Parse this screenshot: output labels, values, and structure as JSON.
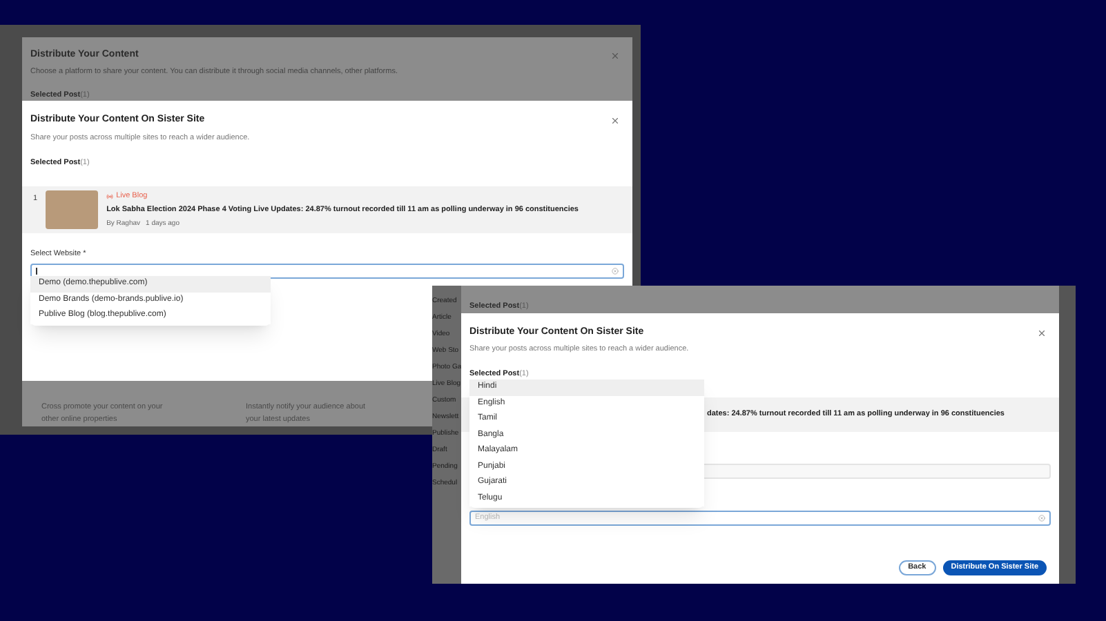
{
  "screenshot_1": {
    "back_modal": {
      "title": "Distribute Your Content",
      "subtitle": "Choose a platform to share your content. You can distribute it through social media channels, other platforms.",
      "selected_label": "Selected Post",
      "selected_count": "(1)",
      "options": [
        {
          "description": "Cross promote your content on your other online properties"
        },
        {
          "description": "Instantly notify your audience about your latest updates"
        }
      ]
    },
    "modal": {
      "title": "Distribute Your Content On Sister Site",
      "subtitle": "Share your posts across multiple sites to reach a wider audience.",
      "selected_label": "Selected Post",
      "selected_count": "(1)",
      "post": {
        "number": "1",
        "tag": "Live Blog",
        "headline": "Lok Sabha Election 2024 Phase 4 Voting Live Updates: 24.87% turnout recorded till 11 am as polling underway in 96 constituencies",
        "author": "By Raghav",
        "time": "1 days ago"
      },
      "website_label": "Select Website *",
      "website_options": [
        {
          "label": "Demo (demo.thepublive.com)",
          "selected": true
        },
        {
          "label": "Demo Brands (demo-brands.publive.io)",
          "selected": false
        },
        {
          "label": "Publive Blog (blog.thepublive.com)",
          "selected": false
        }
      ]
    }
  },
  "screenshot_2": {
    "sidebar": [
      "Created",
      "Article",
      "Video",
      "Web Sto",
      "Photo Ga",
      "Live Blog",
      "Custom",
      "Newslett",
      "Publishe",
      "Draft",
      "Pending",
      "Schedul"
    ],
    "back_selected_label": "Selected Post",
    "back_selected_count": "(1)",
    "modal": {
      "title": "Distribute Your Content On Sister Site",
      "subtitle": "Share your posts across multiple sites to reach a wider audience.",
      "selected_label": "Selected Post",
      "selected_count": "(1)",
      "headline_visible": "dates: 24.87% turnout recorded till 11 am as polling underway in 96 constituencies",
      "language_placeholder": "English",
      "language_options": [
        {
          "label": "Hindi",
          "selected": true
        },
        {
          "label": "English",
          "selected": false
        },
        {
          "label": "Tamil",
          "selected": false
        },
        {
          "label": "Bangla",
          "selected": false
        },
        {
          "label": "Malayalam",
          "selected": false
        },
        {
          "label": "Punjabi",
          "selected": false
        },
        {
          "label": "Gujarati",
          "selected": false
        },
        {
          "label": "Telugu",
          "selected": false
        }
      ],
      "buttons": [
        {
          "label": "Back",
          "kind": "secondary"
        },
        {
          "label": "Distribute On Sister Site",
          "kind": "primary"
        }
      ]
    }
  }
}
